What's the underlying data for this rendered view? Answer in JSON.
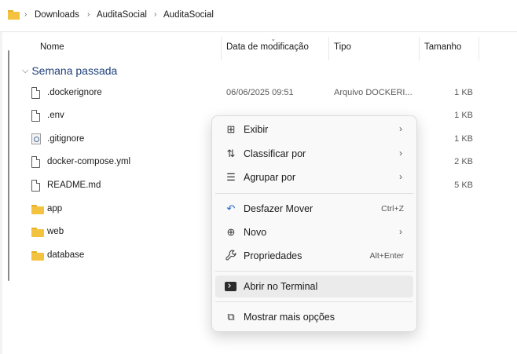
{
  "breadcrumb": {
    "items": [
      "Downloads",
      "AuditaSocial",
      "AuditaSocial"
    ],
    "separator": "›"
  },
  "columns": {
    "name": "Nome",
    "date": "Data de modificação",
    "type": "Tipo",
    "size": "Tamanho"
  },
  "group": {
    "label": "Semana passada",
    "chevron": "⌵"
  },
  "files": [
    {
      "name": ".dockerignore",
      "date": "06/06/2025 09:51",
      "type": "Arquivo DOCKERI...",
      "size": "1 KB",
      "icon": "file-icon"
    },
    {
      "name": ".env",
      "date": "",
      "type": "",
      "size": "1 KB",
      "icon": "file-icon"
    },
    {
      "name": ".gitignore",
      "date": "",
      "type": "",
      "size": "1 KB",
      "icon": "gear-file-icon"
    },
    {
      "name": "docker-compose.yml",
      "date": "",
      "type": "",
      "size": "2 KB",
      "icon": "file-icon"
    },
    {
      "name": "README.md",
      "date": "",
      "type": "",
      "size": "5 KB",
      "icon": "file-icon"
    },
    {
      "name": "app",
      "date": "",
      "type": "",
      "size": "",
      "icon": "folder-icon"
    },
    {
      "name": "web",
      "date": "",
      "type": "",
      "size": "",
      "icon": "folder-icon"
    },
    {
      "name": "database",
      "date": "",
      "type": "",
      "size": "",
      "icon": "folder-icon"
    }
  ],
  "context_menu": {
    "items": [
      {
        "label": "Exibir",
        "icon": "view-grid-icon",
        "glyph": "⊞",
        "shortcut": "",
        "submenu": true
      },
      {
        "label": "Classificar por",
        "icon": "sort-icon",
        "glyph": "⇅",
        "shortcut": "",
        "submenu": true
      },
      {
        "label": "Agrupar por",
        "icon": "group-icon",
        "glyph": "☰",
        "shortcut": "",
        "submenu": true
      },
      {
        "label": "Desfazer Mover",
        "icon": "undo-icon",
        "glyph": "↶",
        "shortcut": "Ctrl+Z",
        "submenu": false
      },
      {
        "label": "Novo",
        "icon": "new-icon",
        "glyph": "⊕",
        "shortcut": "",
        "submenu": true
      },
      {
        "label": "Propriedades",
        "icon": "wrench-icon",
        "glyph": "🔧",
        "shortcut": "Alt+Enter",
        "submenu": false
      },
      {
        "label": "Abrir no Terminal",
        "icon": "terminal-icon",
        "glyph": "",
        "shortcut": "",
        "submenu": false
      },
      {
        "label": "Mostrar mais opções",
        "icon": "more-options-icon",
        "glyph": "⧉",
        "shortcut": "",
        "submenu": false
      }
    ],
    "submenu_arrow": "›"
  },
  "colors": {
    "accent_text": "#1f3f7a",
    "folder": "#f3c33f",
    "menu_bg": "#f9f9f9",
    "menu_highlight": "#ebebeb"
  }
}
